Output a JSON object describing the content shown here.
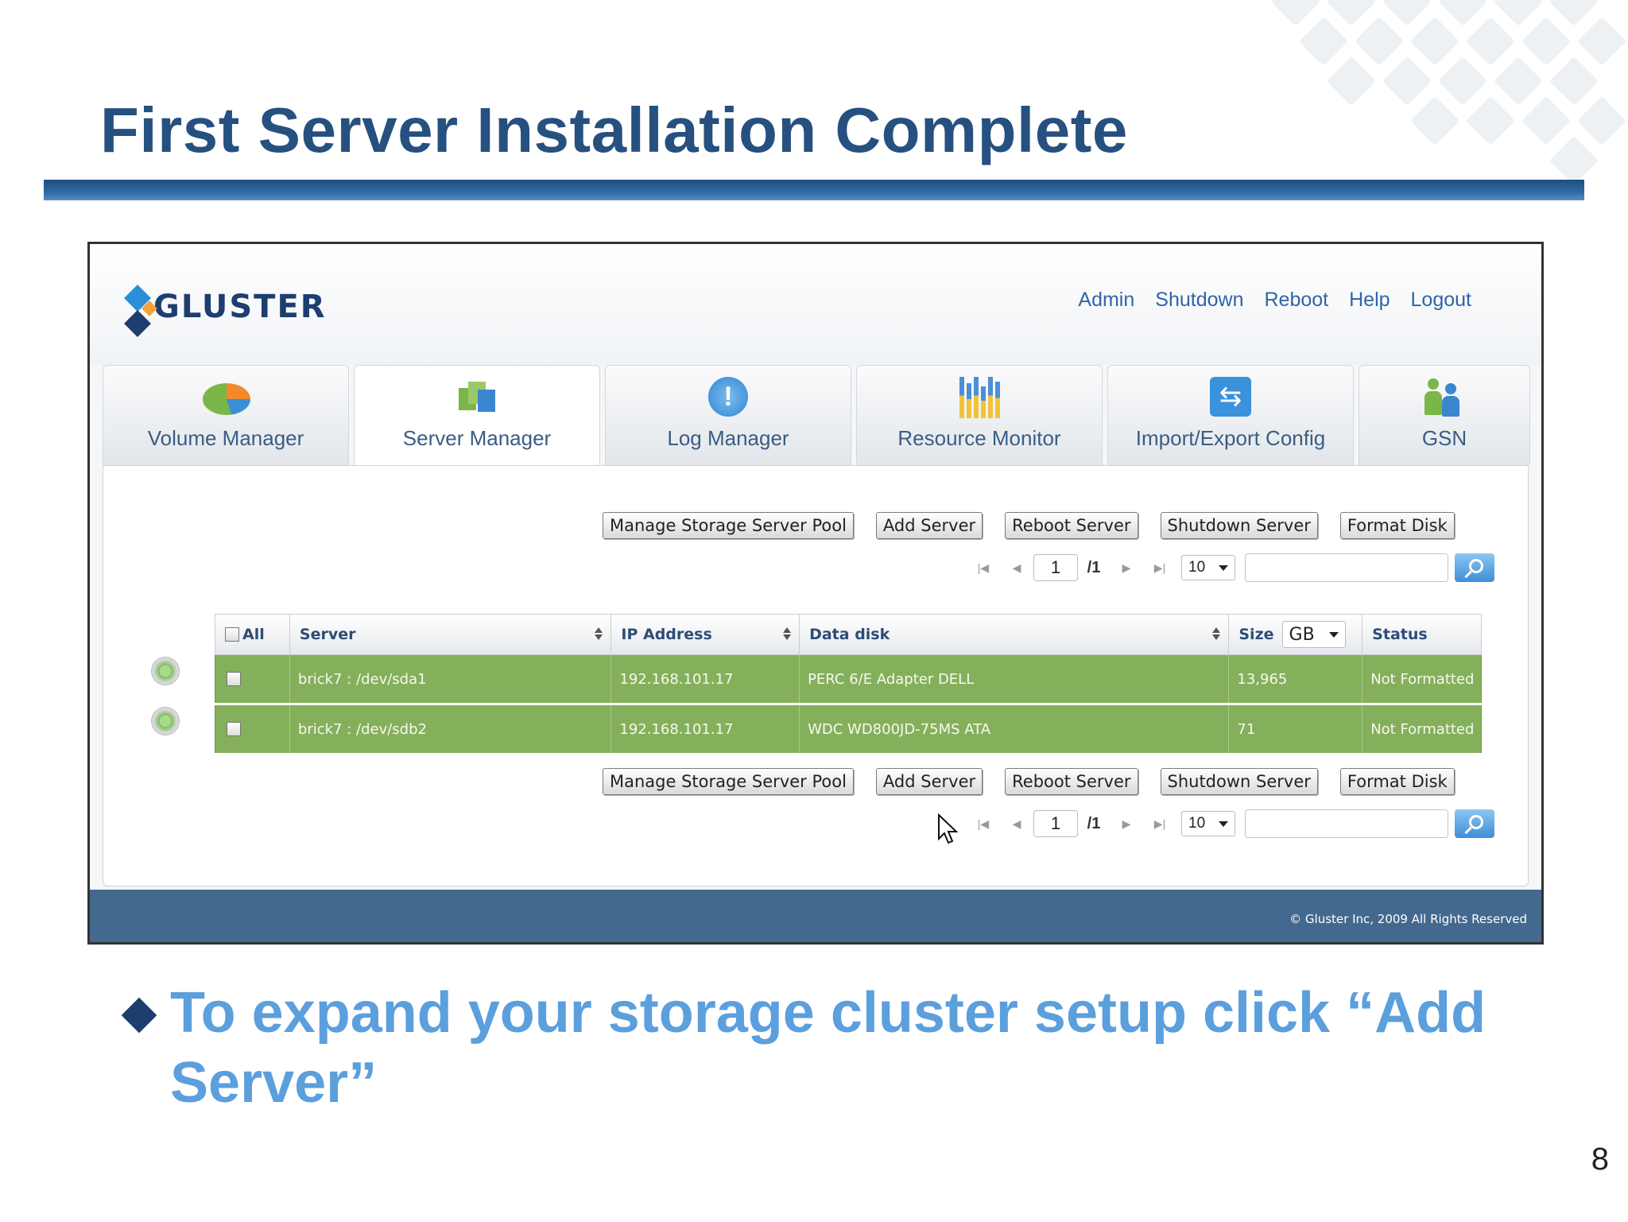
{
  "slide": {
    "title": "First Server Installation Complete",
    "bullet": "To expand your storage cluster setup click “Add Server”",
    "page_number": "8"
  },
  "app": {
    "logo_text": "GLUSTER",
    "top_links": [
      "Admin",
      "Shutdown",
      "Reboot",
      "Help",
      "Logout"
    ],
    "tabs": [
      {
        "label": "Volume Manager",
        "icon": "pie-chart-icon"
      },
      {
        "label": "Server Manager",
        "icon": "server-boxes-icon"
      },
      {
        "label": "Log Manager",
        "icon": "alert-icon"
      },
      {
        "label": "Resource Monitor",
        "icon": "bar-chart-icon"
      },
      {
        "label": "Import/Export Config",
        "icon": "import-export-icon"
      },
      {
        "label": "GSN",
        "icon": "users-icon"
      }
    ],
    "active_tab": "Server Manager",
    "actions": [
      "Manage Storage Server Pool",
      "Add Server",
      "Reboot Server",
      "Shutdown Server",
      "Format Disk"
    ],
    "pager": {
      "page": "1",
      "total": "/1",
      "per_page": "10",
      "search_value": ""
    },
    "table": {
      "select_all_label": "All",
      "columns": [
        "Server",
        "IP Address",
        "Data disk",
        "Size",
        "Status"
      ],
      "size_unit": "GB",
      "rows": [
        {
          "server": "brick7 : /dev/sda1",
          "ip": "192.168.101.17",
          "disk": "PERC 6/E Adapter DELL",
          "size": "13,965",
          "status": "Not Formatted"
        },
        {
          "server": "brick7 : /dev/sdb2",
          "ip": "192.168.101.17",
          "disk": "WDC WD800JD-75MS ATA",
          "size": "71",
          "status": "Not Formatted"
        }
      ]
    },
    "copyright": "© Gluster Inc, 2009 All Rights Reserved",
    "colors": {
      "row_green": "#85b05b",
      "footer_blue": "#43698f",
      "title_blue": "#26507f",
      "bullet_blue": "#5b9fdd"
    }
  }
}
